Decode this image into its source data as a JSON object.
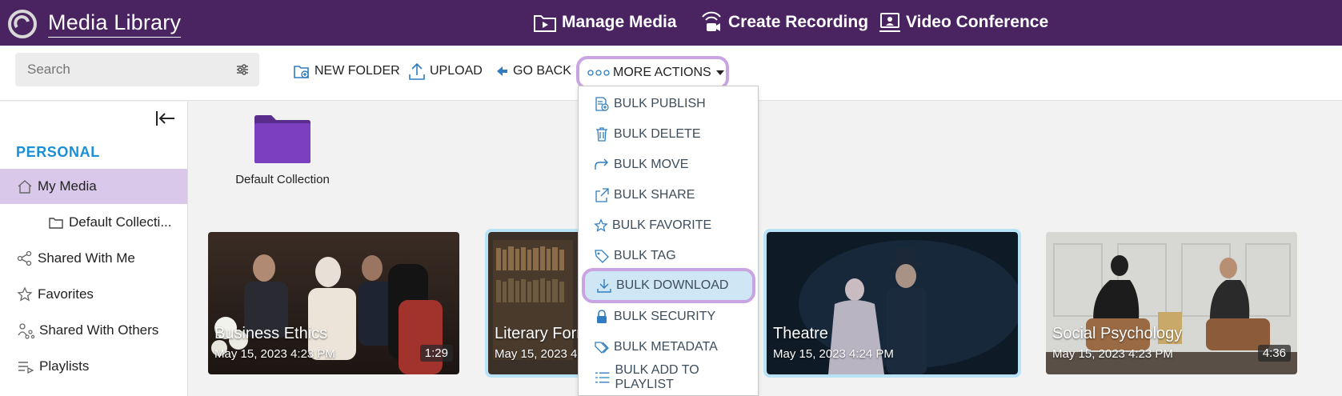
{
  "app": {
    "title": "Media Library"
  },
  "topnav": [
    {
      "label": "Manage Media",
      "icon": "video-folder-icon"
    },
    {
      "label": "Create Recording",
      "icon": "webcam-icon"
    },
    {
      "label": "Video Conference",
      "icon": "conference-icon"
    }
  ],
  "search": {
    "placeholder": "Search",
    "value": ""
  },
  "toolbar": {
    "new_folder": "NEW FOLDER",
    "upload": "UPLOAD",
    "go_back": "GO BACK",
    "more_actions": "MORE ACTIONS"
  },
  "sidebar": {
    "section": "PERSONAL",
    "items": [
      {
        "label": "My Media",
        "icon": "home-icon",
        "active": true
      },
      {
        "label": "Default Collecti...",
        "icon": "folder-icon"
      },
      {
        "label": "Shared With Me",
        "icon": "share-icon"
      },
      {
        "label": "Favorites",
        "icon": "star-icon"
      },
      {
        "label": "Shared With Others",
        "icon": "users-share-icon"
      },
      {
        "label": "Playlists",
        "icon": "playlist-icon"
      }
    ]
  },
  "folders": [
    {
      "label": "Default Collection",
      "color": "#7b3fbf"
    }
  ],
  "media": [
    {
      "title": "Business Ethics",
      "date": "May 15, 2023 4:23 PM",
      "duration": "1:29",
      "selected": false
    },
    {
      "title": "Literary Form",
      "date": "May 15, 2023 4:",
      "duration": "",
      "selected": true
    },
    {
      "title": "Theatre",
      "date": "May 15, 2023 4:24 PM",
      "duration": "",
      "selected": true
    },
    {
      "title": "Social Psychology",
      "date": "May 15, 2023 4:23 PM",
      "duration": "4:36",
      "selected": false
    }
  ],
  "dropdown": {
    "items": [
      {
        "label": "BULK PUBLISH",
        "icon": "publish-icon"
      },
      {
        "label": "BULK DELETE",
        "icon": "trash-icon"
      },
      {
        "label": "BULK MOVE",
        "icon": "move-icon"
      },
      {
        "label": "BULK SHARE",
        "icon": "share-out-icon"
      },
      {
        "label": "BULK FAVORITE",
        "icon": "star-icon"
      },
      {
        "label": "BULK TAG",
        "icon": "tag-icon"
      },
      {
        "label": "BULK DOWNLOAD",
        "icon": "download-icon",
        "highlighted": true
      },
      {
        "label": "BULK SECURITY",
        "icon": "lock-icon"
      },
      {
        "label": "BULK METADATA",
        "icon": "metadata-icon"
      },
      {
        "label": "BULK ADD TO PLAYLIST",
        "icon": "playlist-add-icon"
      }
    ]
  },
  "colors": {
    "topbar": "#4a2460",
    "accent_purple": "#c9a4e2",
    "active_sidebar": "#d9c8ea",
    "section_blue": "#1a8fd6",
    "icon_blue": "#2f7dc0",
    "highlight_bg": "#cfe7f5",
    "selected_outline": "#b8e2f6"
  }
}
